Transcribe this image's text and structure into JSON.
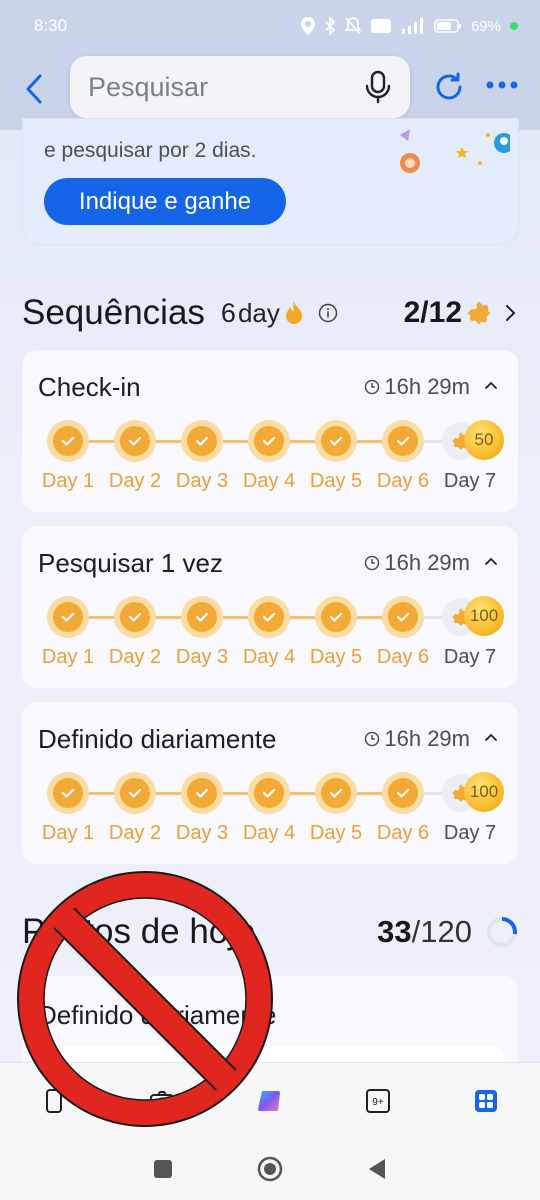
{
  "status_bar": {
    "time": "8:30",
    "battery": "69%"
  },
  "nav": {
    "search_placeholder": "Pesquisar"
  },
  "promo": {
    "text": "e pesquisar por 2 dias.",
    "button": "Indique e ganhe"
  },
  "streaks": {
    "title": "Sequências",
    "streak_num": "6",
    "streak_unit": "day",
    "count": "2/12",
    "tasks": [
      {
        "title": "Check-in",
        "timer": "16h 29m",
        "reward": "50",
        "days": [
          "Day 1",
          "Day 2",
          "Day 3",
          "Day 4",
          "Day 5",
          "Day 6",
          "Day 7"
        ]
      },
      {
        "title": "Pesquisar 1 vez",
        "timer": "16h 29m",
        "reward": "100",
        "days": [
          "Day 1",
          "Day 2",
          "Day 3",
          "Day 4",
          "Day 5",
          "Day 6",
          "Day 7"
        ]
      },
      {
        "title": "Definido diariamente",
        "timer": "16h 29m",
        "reward": "100",
        "days": [
          "Day 1",
          "Day 2",
          "Day 3",
          "Day 4",
          "Day 5",
          "Day 6",
          "Day 7"
        ]
      }
    ]
  },
  "points": {
    "title": "Pontos de hoje",
    "current": "33",
    "total": "/120",
    "progress": 0.275,
    "card_title": "Definido diariamente"
  },
  "tabs": [
    {
      "icon": "phone-icon"
    },
    {
      "icon": "camera-icon"
    },
    {
      "icon": "copilot-icon"
    },
    {
      "icon": "tabs-count-icon",
      "label": "9+"
    },
    {
      "icon": "apps-grid-icon"
    }
  ],
  "colors": {
    "accent": "#1565e8",
    "streak_orange": "#f3a935",
    "prohibit_red": "#e0261f"
  }
}
